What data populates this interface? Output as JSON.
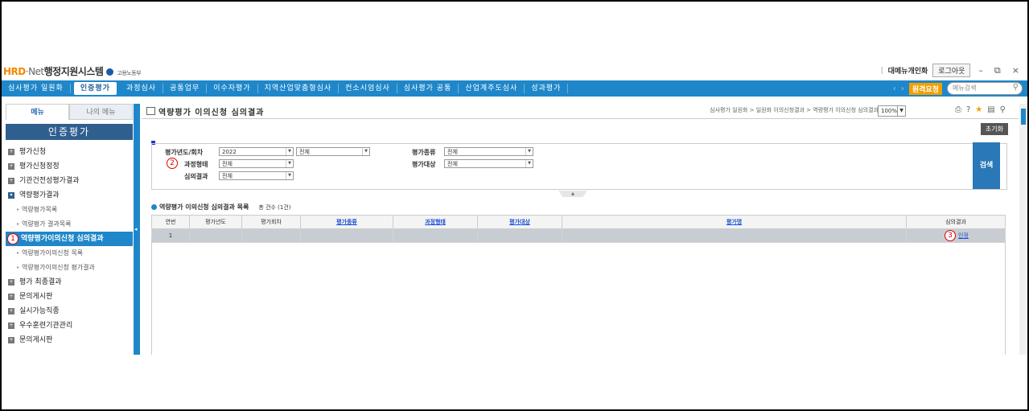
{
  "app": {
    "logo_hrd": "HRD",
    "logo_net": "·Net",
    "logo_system": "행정지원시스템",
    "logo_ministry": "고용노동부",
    "top_right": {
      "menu_customize": "대메뉴개인화",
      "logout": "로그아웃"
    }
  },
  "nav": {
    "items": [
      "심사평가 일원화",
      "인증평가",
      "과정심사",
      "공통업무",
      "이수자평가",
      "지역산업맞춤형심사",
      "컨소시엄심사",
      "심사평가 공통",
      "산업계주도심사",
      "성과평가"
    ],
    "request_btn": "원격요청",
    "menu_search_placeholder": "메뉴검색"
  },
  "sidebar": {
    "tab_menu": "메뉴",
    "tab_my_menu": "나의 메뉴",
    "header": "인증평가",
    "items": [
      "평가신청",
      "평가신청정정",
      "기관건전성평가결과",
      "역량평가결과",
      "역량평가목록",
      "역량평가 결과목록",
      "역량평가이의신청 심의결과",
      "역량평가이의신청 목록",
      "역량평가이의신청 평가결과",
      "평가 최종결과",
      "문의게시판",
      "실시가능직종",
      "우수훈련기관관리",
      "문의게시판"
    ],
    "marker1": "1"
  },
  "page": {
    "title": "역량평가 이의신청 심의결과",
    "breadcrumb": "심사평가 일원화 > 일원화 이의신청결과 > 역량평가 이의신청 심의결과",
    "zoom": "100%",
    "reset_btn": "초기화",
    "search_btn": "검색",
    "marker2": "2",
    "marker3": "3"
  },
  "filters": {
    "year_label": "평가년도/회차",
    "year_value": "2022",
    "round_value": "전체",
    "course_type_label": "과정형태",
    "course_type_value": "전체",
    "review_result_label": "심의결과",
    "review_result_value": "전체",
    "eval_type_label": "평가종류",
    "eval_type_value": "전체",
    "eval_target_label": "평가대상",
    "eval_target_value": "전체"
  },
  "list": {
    "title": "역량평가 이의신청 심의결과 목록",
    "count": "총 건수 (1건)",
    "columns": [
      "연번",
      "평가년도",
      "평가회차",
      "평가종류",
      "과정형태",
      "평가대상",
      "평가명",
      "심의결과"
    ],
    "rows": [
      {
        "no": "1",
        "year": "",
        "round": "",
        "eval_type": "",
        "course_type": "",
        "target": "",
        "name": "",
        "result": "인정"
      }
    ]
  }
}
